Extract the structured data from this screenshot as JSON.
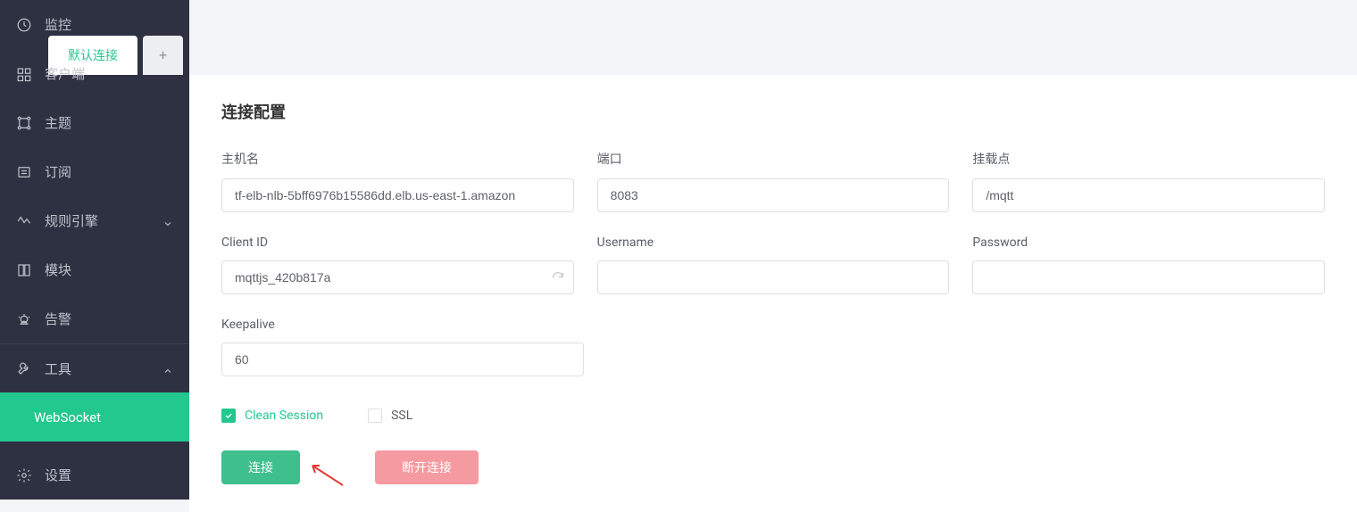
{
  "sidebar": {
    "items": [
      {
        "label": "监控",
        "icon": "dashboard"
      },
      {
        "label": "客户端",
        "icon": "clients"
      },
      {
        "label": "主题",
        "icon": "topics"
      },
      {
        "label": "订阅",
        "icon": "subscriptions"
      },
      {
        "label": "规则引擎",
        "icon": "rules",
        "chev": "down"
      },
      {
        "label": "模块",
        "icon": "modules"
      },
      {
        "label": "告警",
        "icon": "alarm"
      },
      {
        "label": "工具",
        "icon": "tools",
        "chev": "up"
      }
    ],
    "sub": {
      "websocket": "WebSocket"
    },
    "bottom": {
      "settings": "设置"
    }
  },
  "tabs": {
    "active": "默认连接"
  },
  "section_title": "连接配置",
  "form": {
    "host": {
      "label": "主机名",
      "value": "tf-elb-nlb-5bff6976b15586dd.elb.us-east-1.amazon"
    },
    "port": {
      "label": "端口",
      "value": "8083"
    },
    "mount": {
      "label": "挂载点",
      "value": "/mqtt"
    },
    "client_id": {
      "label": "Client ID",
      "value": "mqttjs_420b817a"
    },
    "username": {
      "label": "Username",
      "value": ""
    },
    "password": {
      "label": "Password",
      "value": ""
    },
    "keepalive": {
      "label": "Keepalive",
      "value": "60"
    }
  },
  "checks": {
    "clean_session": {
      "label": "Clean Session",
      "checked": true
    },
    "ssl": {
      "label": "SSL",
      "checked": false
    }
  },
  "buttons": {
    "connect": "连接",
    "disconnect": "断开连接"
  },
  "colors": {
    "accent": "#23c88e",
    "danger": "#f59aa0",
    "sidebar_bg": "#2d3142"
  }
}
